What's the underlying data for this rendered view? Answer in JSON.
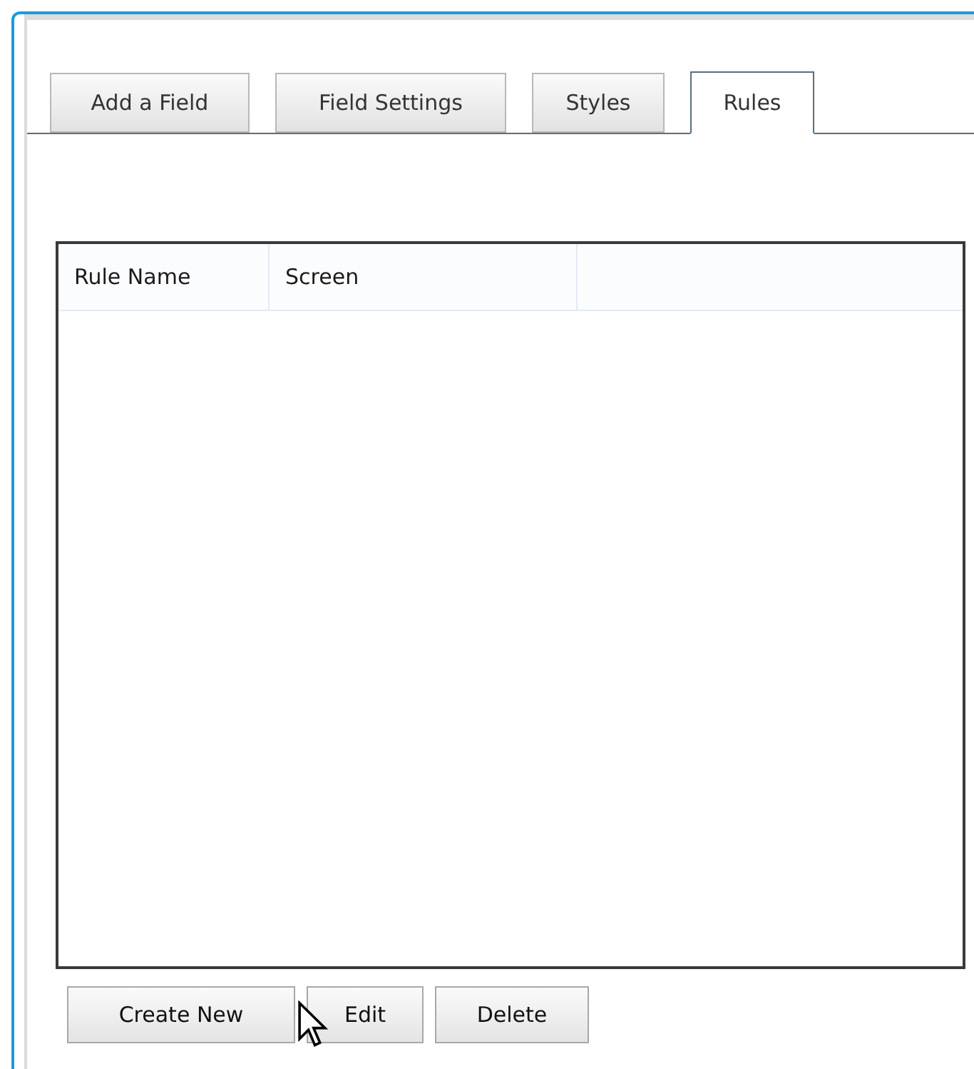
{
  "tabs": [
    {
      "label": "Add a Field",
      "selected": false
    },
    {
      "label": "Field Settings",
      "selected": false
    },
    {
      "label": "Styles",
      "selected": false
    },
    {
      "label": "Rules",
      "selected": true
    }
  ],
  "table": {
    "columns": [
      "Rule Name",
      "Screen"
    ]
  },
  "buttons": [
    "Create New",
    "Edit",
    "Delete"
  ]
}
